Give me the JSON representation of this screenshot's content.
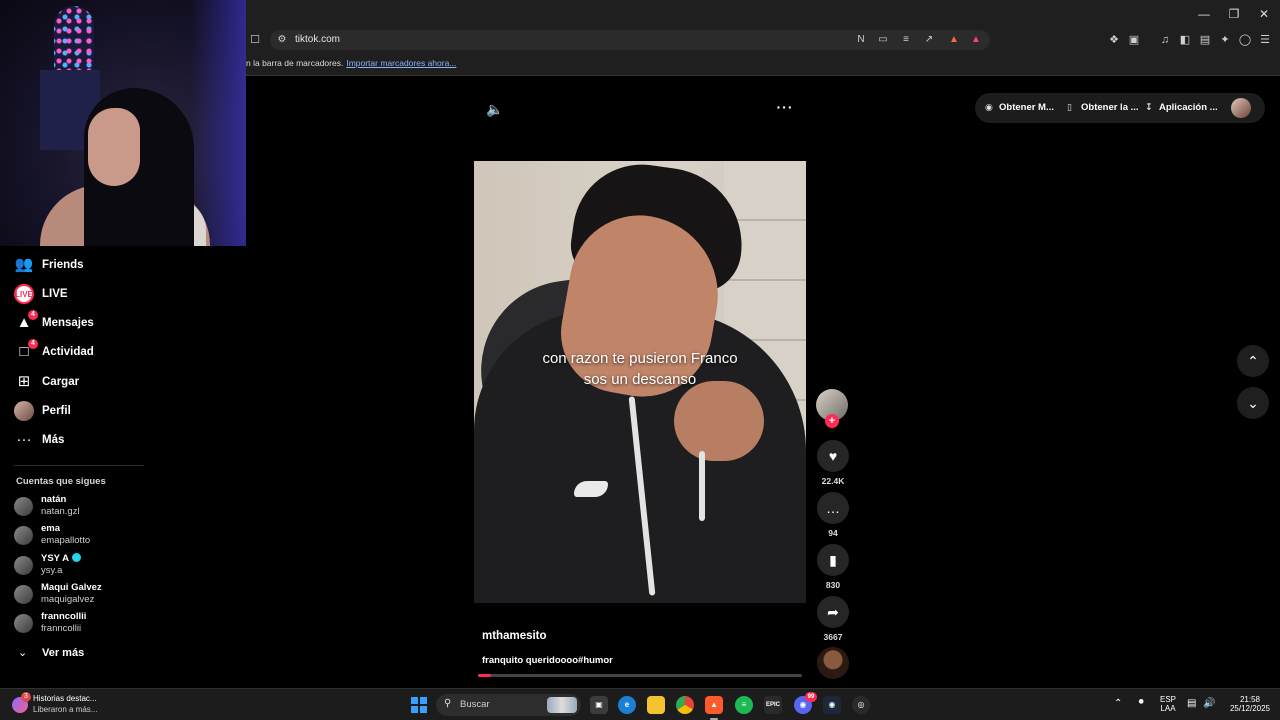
{
  "browser": {
    "url": "tiktok.com",
    "bookmark_bar_text": "n la barra de marcadores.",
    "bookmark_bar_link": "Importar marcadores ahora..."
  },
  "sidebar": {
    "nav": [
      {
        "label": "Friends",
        "icon": "friends-icon"
      },
      {
        "label": "LIVE",
        "icon": "live-icon"
      },
      {
        "label": "Mensajes",
        "icon": "messages-icon",
        "badge": "4"
      },
      {
        "label": "Actividad",
        "icon": "activity-icon",
        "badge": "4"
      },
      {
        "label": "Cargar",
        "icon": "upload-icon"
      },
      {
        "label": "Perfil",
        "icon": "profile-avatar"
      },
      {
        "label": "Más",
        "icon": "more-icon"
      }
    ],
    "following_title": "Cuentas que sigues",
    "following": [
      {
        "name": "natán",
        "handle": "natan.gzl",
        "verified": false
      },
      {
        "name": "ema",
        "handle": "emapallotto",
        "verified": false
      },
      {
        "name": "YSY A",
        "handle": "ysy.a",
        "verified": true
      },
      {
        "name": "Maqui Galvez",
        "handle": "maquigalvez",
        "verified": false
      },
      {
        "name": "franncollii",
        "handle": "franncollii",
        "verified": false
      }
    ],
    "see_more": "Ver más"
  },
  "top_actions": {
    "btn1": "Obtener M...",
    "btn2": "Obtener la ...",
    "btn3": "Aplicación ..."
  },
  "video": {
    "caption_line1": "con razon te pusieron Franco",
    "caption_line2": "sos un descanso",
    "author": "mthamesito",
    "description": "franquito queridoooo#humor",
    "progress": 0.04
  },
  "actions": {
    "likes": "22.4K",
    "comments": "94",
    "saves": "830",
    "shares": "3667"
  },
  "taskbar": {
    "notif_count": "3",
    "notif_line1": "Historias destac...",
    "notif_line2": "Liberaron a más...",
    "search_placeholder": "Buscar",
    "lang1": "ESP",
    "lang2": "LAA",
    "time": "21:58",
    "date": "25/12/2025",
    "discord_badge": "99"
  },
  "colors": {
    "accent": "#fe2c55",
    "verified": "#20d5ec"
  }
}
